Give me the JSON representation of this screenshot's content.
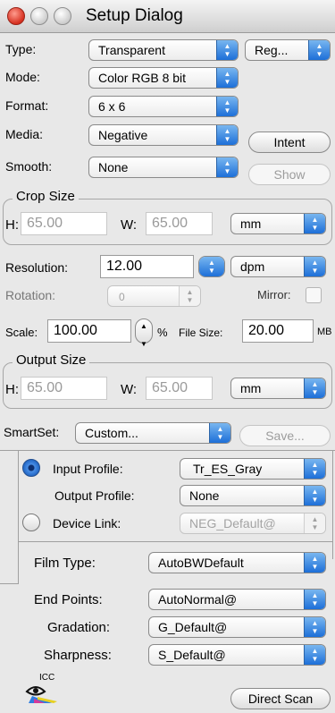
{
  "window": {
    "title": "Setup Dialog"
  },
  "type": {
    "label": "Type:",
    "value": "Transparent",
    "region_value": "Reg..."
  },
  "mode": {
    "label": "Mode:",
    "value": "Color RGB 8 bit"
  },
  "format": {
    "label": "Format:",
    "value": "6 x 6"
  },
  "media": {
    "label": "Media:",
    "value": "Negative",
    "intent_button": "Intent"
  },
  "smooth": {
    "label": "Smooth:",
    "value": "None",
    "show_button": "Show"
  },
  "crop": {
    "title": "Crop Size",
    "h_label": "H:",
    "h_value": "65.00",
    "w_label": "W:",
    "w_value": "65.00",
    "unit": "mm"
  },
  "resolution": {
    "label": "Resolution:",
    "value": "12.00",
    "unit": "dpm"
  },
  "rotation": {
    "label": "Rotation:",
    "value": "0",
    "mirror_label": "Mirror:"
  },
  "scale": {
    "label": "Scale:",
    "value": "100.00",
    "percent": "%",
    "filesize_label": "File Size:",
    "filesize_value": "20.00",
    "filesize_unit": "MB"
  },
  "output": {
    "title": "Output Size",
    "h_label": "H:",
    "h_value": "65.00",
    "w_label": "W:",
    "w_value": "65.00",
    "unit": "mm"
  },
  "smartset": {
    "label": "SmartSet:",
    "value": "Custom...",
    "save_button": "Save..."
  },
  "profiles": {
    "input_label": "Input Profile:",
    "input_value": "Tr_ES_Gray",
    "output_label": "Output Profile:",
    "output_value": "None",
    "device_label": "Device Link:",
    "device_value": "NEG_Default@"
  },
  "film": {
    "label": "Film Type:",
    "value": "AutoBWDefault"
  },
  "endpoints": {
    "label": "End Points:",
    "value": "AutoNormal@"
  },
  "gradation": {
    "label": "Gradation:",
    "value": "G_Default@"
  },
  "sharpness": {
    "label": "Sharpness:",
    "value": "S_Default@"
  },
  "footer": {
    "icc_text": "ICC",
    "direct_scan_button": "Direct Scan"
  },
  "colors": {
    "accent": "#1d6fd8",
    "close": "#d62f1f"
  },
  "icons": {
    "popup_arrow": "updown-arrows-icon",
    "logo": "icc-eye-icon"
  }
}
